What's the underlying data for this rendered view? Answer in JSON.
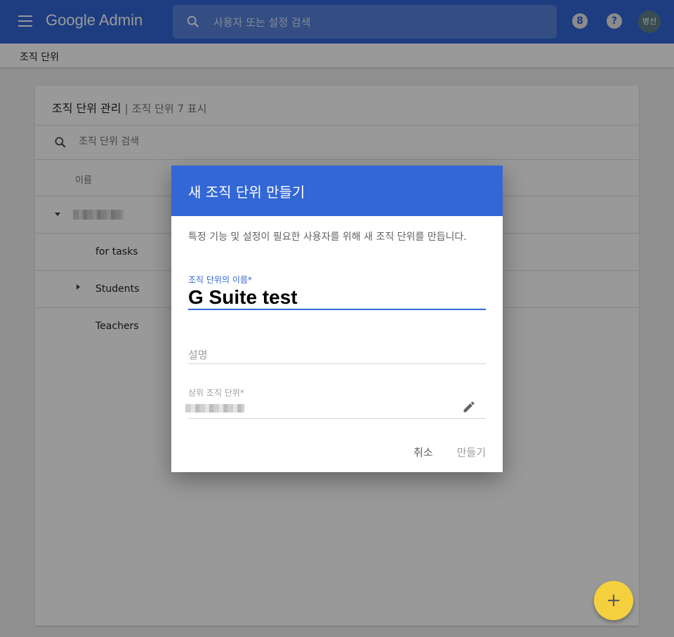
{
  "app": {
    "title": "Google Admin"
  },
  "search": {
    "placeholder": "사용자 또는 설정 검색"
  },
  "header_icons": {
    "counter_label": "8",
    "help_label": "?",
    "avatar_label": "병선"
  },
  "breadcrumb": {
    "label": "조직 단위"
  },
  "card": {
    "title": "조직 단위 관리",
    "separator": "|",
    "subtitle": "조직 단위 7 표시",
    "search_placeholder": "조직 단위 검색",
    "column_header": "이름",
    "rows": [
      {
        "label": "for tasks"
      },
      {
        "label": "Students"
      },
      {
        "label": "Teachers"
      }
    ]
  },
  "dialog": {
    "title": "새 조직 단위 만들기",
    "description": "특정 기능 및 설정이 필요한 사용자를 위해 새 조직 단위를 만듭니다.",
    "name_label": "조직 단위의 이름*",
    "name_value": "G Suite test",
    "description_placeholder": "설명",
    "parent_label": "상위 조직 단위*",
    "cancel_label": "취소",
    "create_label": "만들기"
  },
  "fab": {
    "label": "+"
  },
  "colors": {
    "brand": "#3367d6",
    "fab": "#f4d03f"
  }
}
